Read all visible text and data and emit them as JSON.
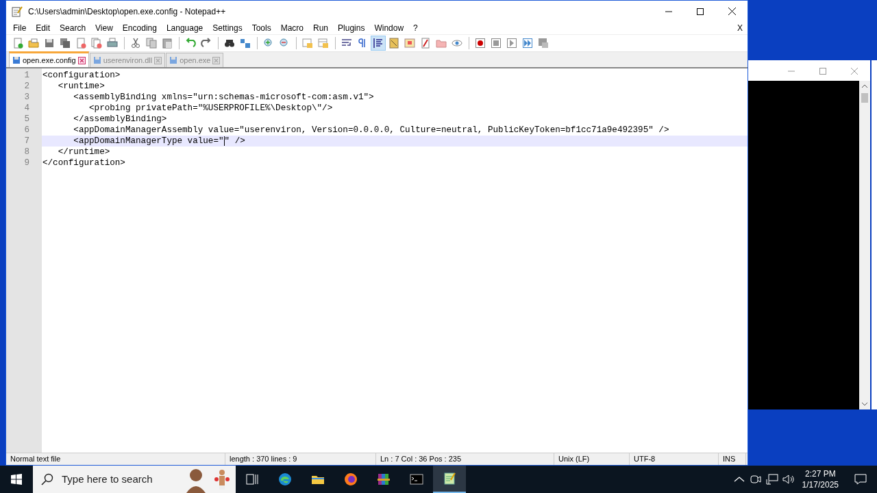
{
  "window": {
    "title": "C:\\Users\\admin\\Desktop\\open.exe.config - Notepad++"
  },
  "menu": [
    "File",
    "Edit",
    "Search",
    "View",
    "Encoding",
    "Language",
    "Settings",
    "Tools",
    "Macro",
    "Run",
    "Plugins",
    "Window",
    "?"
  ],
  "menu_close": "X",
  "toolbar": [
    [
      {
        "on": false
      },
      {
        "on": false
      },
      {
        "on": false
      },
      {
        "on": false
      },
      {
        "on": false
      },
      {
        "on": false
      },
      {
        "on": false
      }
    ],
    [
      {
        "on": false
      },
      {
        "on": false
      },
      {
        "on": false
      }
    ],
    [
      {
        "on": false
      },
      {
        "on": false
      }
    ],
    [
      {
        "on": false
      },
      {
        "on": false
      }
    ],
    [
      {
        "on": false
      },
      {
        "on": false
      }
    ],
    [
      {
        "on": false
      },
      {
        "on": false
      }
    ],
    [
      {
        "on": false
      },
      {
        "on": false
      },
      {
        "on": true
      },
      {
        "on": false
      },
      {
        "on": false
      },
      {
        "on": false
      },
      {
        "on": false
      },
      {
        "on": false
      }
    ],
    [
      {
        "on": false
      },
      {
        "on": false
      },
      {
        "on": false
      },
      {
        "on": false
      },
      {
        "on": false
      }
    ]
  ],
  "tabs": [
    {
      "label": "open.exe.config",
      "selected": true
    },
    {
      "label": "userenviron.dll",
      "selected": false
    },
    {
      "label": "open.exe",
      "selected": false
    }
  ],
  "editor": {
    "lines": [
      {
        "number": "1",
        "text": "<configuration>",
        "selected": false
      },
      {
        "number": "2",
        "text": "   <runtime>",
        "selected": false
      },
      {
        "number": "3",
        "text": "      <assemblyBinding xmlns=\"urn:schemas-microsoft-com:asm.v1\">",
        "selected": false
      },
      {
        "number": "4",
        "text": "         <probing privatePath=\"%USERPROFILE%\\Desktop\\\"/>",
        "selected": false
      },
      {
        "number": "5",
        "text": "      </assemblyBinding>",
        "selected": false
      },
      {
        "number": "6",
        "text": "      <appDomainManagerAssembly value=\"userenviron, Version=0.0.0.0, Culture=neutral, PublicKeyToken=bf1cc71a9e492395\" />",
        "selected": false
      },
      {
        "number": "7",
        "text": "      <appDomainManagerType value=\"",
        "text_after_caret": "\" />",
        "selected": true
      },
      {
        "number": "8",
        "text": "   </runtime>",
        "selected": false
      },
      {
        "number": "9",
        "text": "</configuration>",
        "selected": false
      }
    ]
  },
  "status_bar": [
    "Normal text file",
    "length : 370    lines : 9",
    "Ln : 7    Col : 36    Pos : 235",
    "Unix (LF)",
    "UTF-8",
    "INS"
  ],
  "taskbar": {
    "search": {
      "placeholder": "Type here to search"
    },
    "apps": [
      {
        "active": false
      },
      {
        "active": false
      },
      {
        "active": false
      },
      {
        "active": false
      },
      {
        "active": false
      },
      {
        "active": false
      },
      {
        "active": true
      }
    ],
    "time": "2:27 PM",
    "date": "1/17/2025"
  }
}
